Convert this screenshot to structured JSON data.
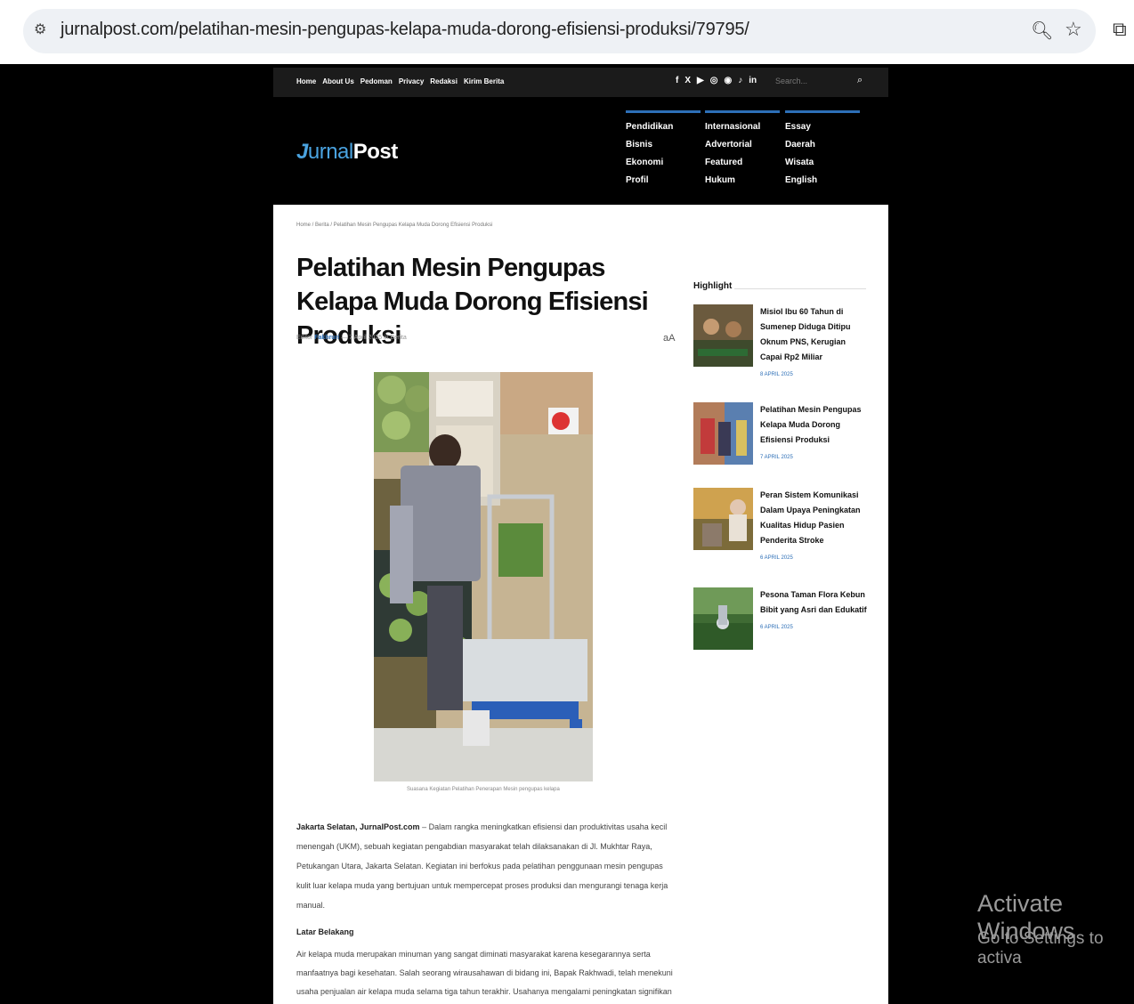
{
  "browser": {
    "url": "jurnalpost.com/pelatihan-mesin-pengupas-kelapa-muda-dorong-efisiensi-produksi/79795/"
  },
  "topbar": {
    "nav": [
      "Home",
      "About Us",
      "Pedoman",
      "Privacy",
      "Redaksi",
      "Kirim Berita"
    ],
    "social": [
      "f",
      "X",
      "▶",
      "◎",
      "◉",
      "♪",
      "in"
    ],
    "search_placeholder": "Search..."
  },
  "header": {
    "logo_j": "J",
    "logo_urnal": "urnal",
    "logo_post": "Post",
    "menu": [
      [
        "Pendidikan",
        "Bisnis",
        "Ekonomi",
        "Profil"
      ],
      [
        "Internasional",
        "Advertorial",
        "Featured",
        "Hukum"
      ],
      [
        "Essay",
        "Daerah",
        "Wisata",
        "English"
      ]
    ]
  },
  "article": {
    "breadcrumb": "Home / Berita / Pelatihan Mesin Pengupas Kelapa Muda Dorong Efisiensi Produksi",
    "title": "Pelatihan Mesin Pengupas Kelapa Muda Dorong Efisiensi Produksi",
    "meta_prefix": "Editor",
    "author": "Fakhruri",
    "meta_suffix": "— 7 April 2025 in Berita",
    "fontsize_icon": "aA",
    "caption": "Suasana Kegiatan Pelatihan Penerapan Mesin pengupas kelapa",
    "lead_bold": "Jakarta Selatan, JurnalPost.com",
    "lead": " – Dalam rangka meningkatkan efisiensi dan produktivitas usaha kecil menengah (UKM), sebuah kegiatan pengabdian masyarakat telah dilaksanakan di Jl. Mukhtar Raya, Petukangan Utara, Jakarta Selatan. Kegiatan ini berfokus pada pelatihan penggunaan mesin pengupas kulit luar kelapa muda yang bertujuan untuk mempercepat proses produksi dan mengurangi tenaga kerja manual.",
    "subhead": "Latar Belakang",
    "para2": "Air kelapa muda merupakan minuman yang sangat diminati masyarakat karena kesegarannya serta manfaatnya bagi kesehatan. Salah seorang wirausahawan di bidang ini, Bapak Rakhwadi, telah menekuni usaha penjualan air kelapa muda selama tiga tahun terakhir. Usahanya mengalami peningkatan signifikan"
  },
  "sidebar": {
    "title": "Highlight",
    "items": [
      {
        "title": "Misiol Ibu 60 Tahun di Sumenep Diduga Ditipu Oknum PNS, Kerugian Capai Rp2 Miliar",
        "date": "8 APRIL 2025"
      },
      {
        "title": "Pelatihan Mesin Pengupas Kelapa Muda Dorong Efisiensi Produksi",
        "date": "7 APRIL 2025"
      },
      {
        "title": "Peran Sistem Komunikasi Dalam Upaya Peningkatan Kualitas Hidup Pasien Penderita Stroke",
        "date": "6 APRIL 2025"
      },
      {
        "title": "Pesona Taman Flora Kebun Bibit yang Asri dan Edukatif",
        "date": "6 APRIL 2025"
      }
    ]
  },
  "os": {
    "watermark_line1": "Activate Windows",
    "watermark_line2": "Go to Settings to activa"
  }
}
